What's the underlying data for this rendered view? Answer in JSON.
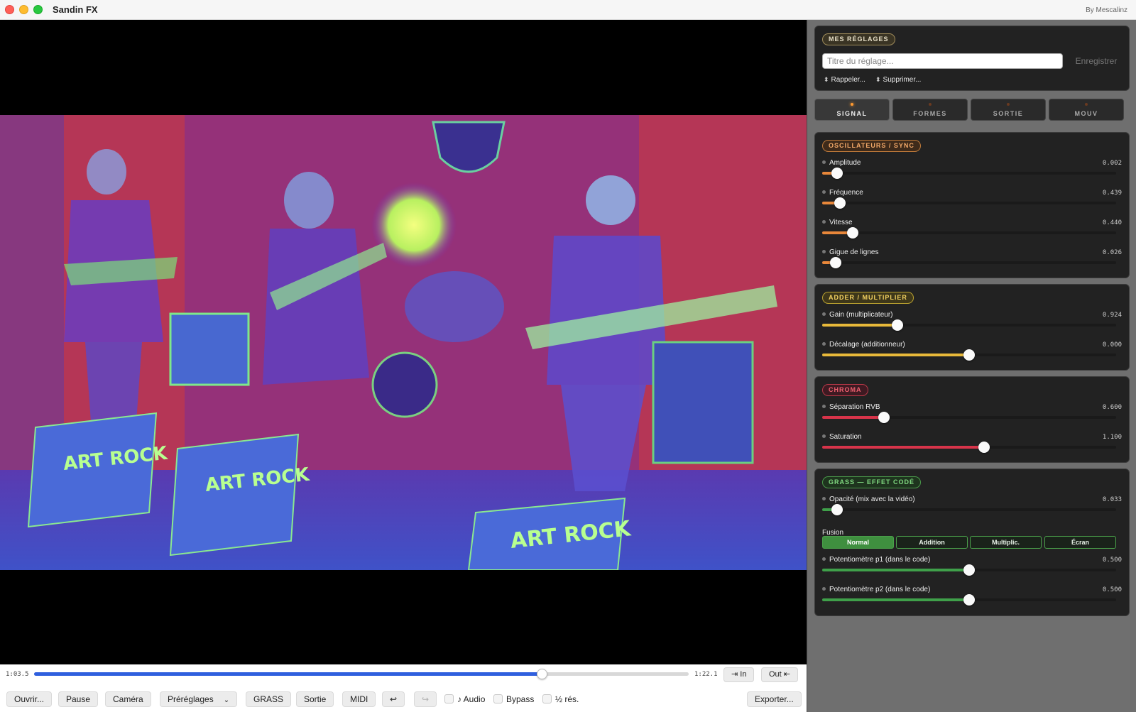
{
  "window": {
    "title": "Sandin FX",
    "credit": "By Mescalinz"
  },
  "timeline": {
    "current": "1:03.5",
    "total": "1:22.1",
    "progress": 0.775,
    "in_label": "⇥ In",
    "out_label": "Out ⇤"
  },
  "toolbar": {
    "open": "Ouvrir...",
    "pause": "Pause",
    "camera": "Caméra",
    "presets": "Préréglages",
    "grass": "GRASS",
    "output": "Sortie",
    "midi": "MIDI",
    "undo": "↩",
    "redo": "↪",
    "audio": "♪ Audio",
    "bypass": "Bypass",
    "half_res": "½ rés.",
    "export": "Exporter..."
  },
  "my_presets": {
    "title": "MES RÉGLAGES",
    "input_placeholder": "Titre du réglage...",
    "save": "Enregistrer",
    "recall": "Rappeler...",
    "delete": "Supprimer..."
  },
  "tabs": [
    {
      "label": "SIGNAL",
      "active": true
    },
    {
      "label": "FORMES",
      "active": false
    },
    {
      "label": "SORTIE",
      "active": false
    },
    {
      "label": "MOUV",
      "active": false
    }
  ],
  "sections": {
    "osc": {
      "title": "OSCILLATEURS / SYNC",
      "color": "#e8873a",
      "params": [
        {
          "label": "Amplitude",
          "value": "0.002",
          "level": 0.05
        },
        {
          "label": "Fréquence",
          "value": "0.439",
          "level": 0.06
        },
        {
          "label": "Vitesse",
          "value": "0.440",
          "level": 0.105
        },
        {
          "label": "Gigue de lignes",
          "value": "0.026",
          "level": 0.045
        }
      ]
    },
    "adder": {
      "title": "ADDER / MULTIPLIER",
      "color": "#e8b93a",
      "params": [
        {
          "label": "Gain (multiplicateur)",
          "value": "0.924",
          "level": 0.255
        },
        {
          "label": "Décalage (additionneur)",
          "value": "0.000",
          "level": 0.5
        }
      ]
    },
    "chroma": {
      "title": "CHROMA",
      "color": "#d8344a",
      "params": [
        {
          "label": "Séparation RVB",
          "value": "0.600",
          "level": 0.21
        },
        {
          "label": "Saturation",
          "value": "1.100",
          "level": 0.55
        }
      ]
    },
    "grass": {
      "title": "GRASS — EFFET CODÉ",
      "color": "#3fa04a",
      "params": [
        {
          "label": "Opacité (mix avec la vidéo)",
          "value": "0.033",
          "level": 0.05
        },
        {
          "label": "Potentiomètre p1 (dans le code)",
          "value": "0.500",
          "level": 0.5
        },
        {
          "label": "Potentiomètre p2 (dans le code)",
          "value": "0.500",
          "level": 0.5
        }
      ],
      "fusion_label": "Fusion",
      "fusion_modes": [
        {
          "label": "Normal",
          "active": true
        },
        {
          "label": "Addition",
          "active": false
        },
        {
          "label": "Multiplic.",
          "active": false
        },
        {
          "label": "Écran",
          "active": false
        }
      ]
    }
  },
  "video": {
    "amp_text_1": "ART ROCK",
    "amp_text_2": "ART ROCK",
    "amp_text_3": "ART ROCK"
  }
}
